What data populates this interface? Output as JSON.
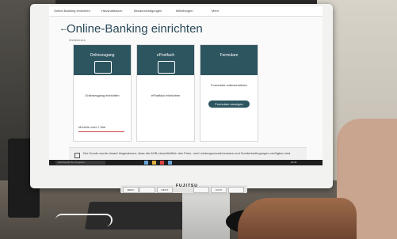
{
  "nav_items": [
    "Online-Banking einrichten",
    "Haushaltsbuch",
    "Benachrichtigungen",
    "Mitteilungen",
    "Mehr"
  ],
  "page": {
    "title": "Online-Banking einrichten",
    "subtitle": "Weiterlesen",
    "cards": [
      {
        "title": "Onlinezugang",
        "label": "Onlinezugang einrichten",
        "text": "",
        "select": "Modelle oder 2 Mal"
      },
      {
        "title": "ePostfach",
        "label": "ePostfach einrichten",
        "text": ""
      },
      {
        "title": "Formulare",
        "label": "Formulare unterschreiben",
        "button": "Formulare anzeigen"
      }
    ],
    "checkbox_text": "Der Kunde wurde darauf hingewiesen, dass die AGB einschließlich des Preis- und Leistungsverzeichnisses und Sonderbedingungen verfügbar sind"
  },
  "taskbar": {
    "search": "Suchbegriff hier eingeben",
    "clock": "10:41"
  },
  "monitor": {
    "brand": "FUJITSU",
    "buttons": [
      "MENU",
      "",
      "INPUT",
      "",
      "",
      "AUTO",
      ""
    ]
  }
}
